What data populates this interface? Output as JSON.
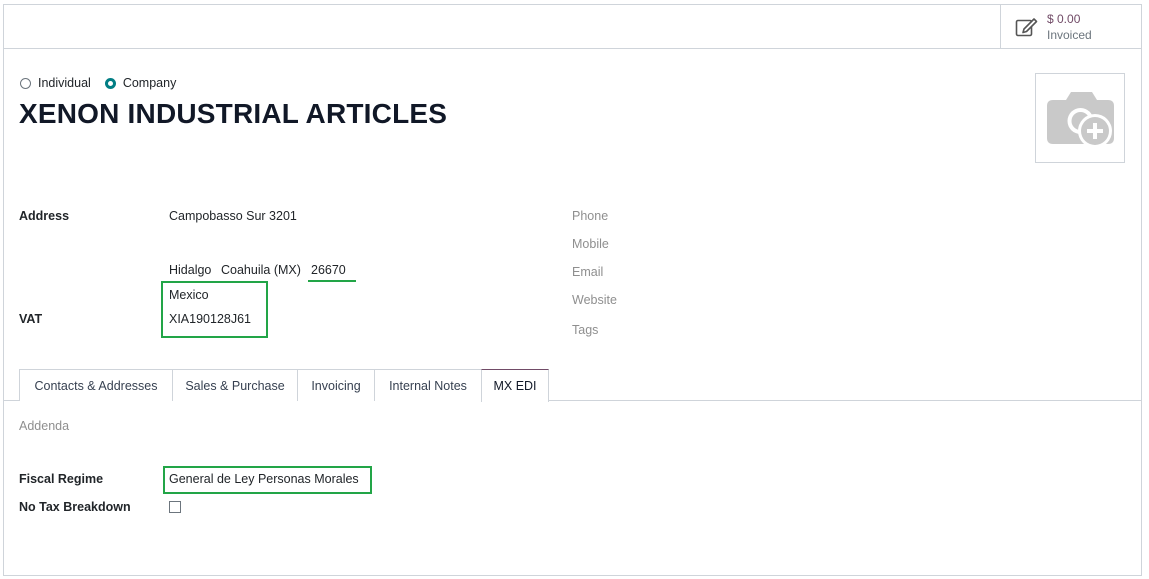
{
  "stat_button": {
    "value": "$ 0.00",
    "label": "Invoiced",
    "icon": "pencil-square-icon"
  },
  "company_type": {
    "options": [
      {
        "label": "Individual",
        "checked": false
      },
      {
        "label": "Company",
        "checked": true
      }
    ]
  },
  "partner_name": "XENON INDUSTRIAL ARTICLES",
  "avatar": {
    "icon": "camera-plus-icon"
  },
  "address": {
    "label": "Address",
    "street": "Campobasso Sur 3201",
    "city": "Hidalgo",
    "state": "Coahuila (MX)",
    "zip": "26670",
    "country": "Mexico"
  },
  "vat": {
    "label": "VAT",
    "value": "XIA190128J61"
  },
  "contact_labels": [
    "Phone",
    "Mobile",
    "Email",
    "Website",
    "Tags"
  ],
  "tabs": [
    {
      "label": "Contacts & Addresses",
      "active": false
    },
    {
      "label": "Sales & Purchase",
      "active": false
    },
    {
      "label": "Invoicing",
      "active": false
    },
    {
      "label": "Internal Notes",
      "active": false
    },
    {
      "label": "MX EDI",
      "active": true
    }
  ],
  "mx_edi": {
    "addenda_label": "Addenda",
    "fiscal_regime_label": "Fiscal Regime",
    "fiscal_regime_value": "General de Ley Personas Morales",
    "no_tax_breakdown_label": "No Tax Breakdown",
    "no_tax_breakdown_checked": false
  },
  "colors": {
    "accent": "#714b67",
    "radio": "#017e84",
    "highlight": "#22a547"
  }
}
